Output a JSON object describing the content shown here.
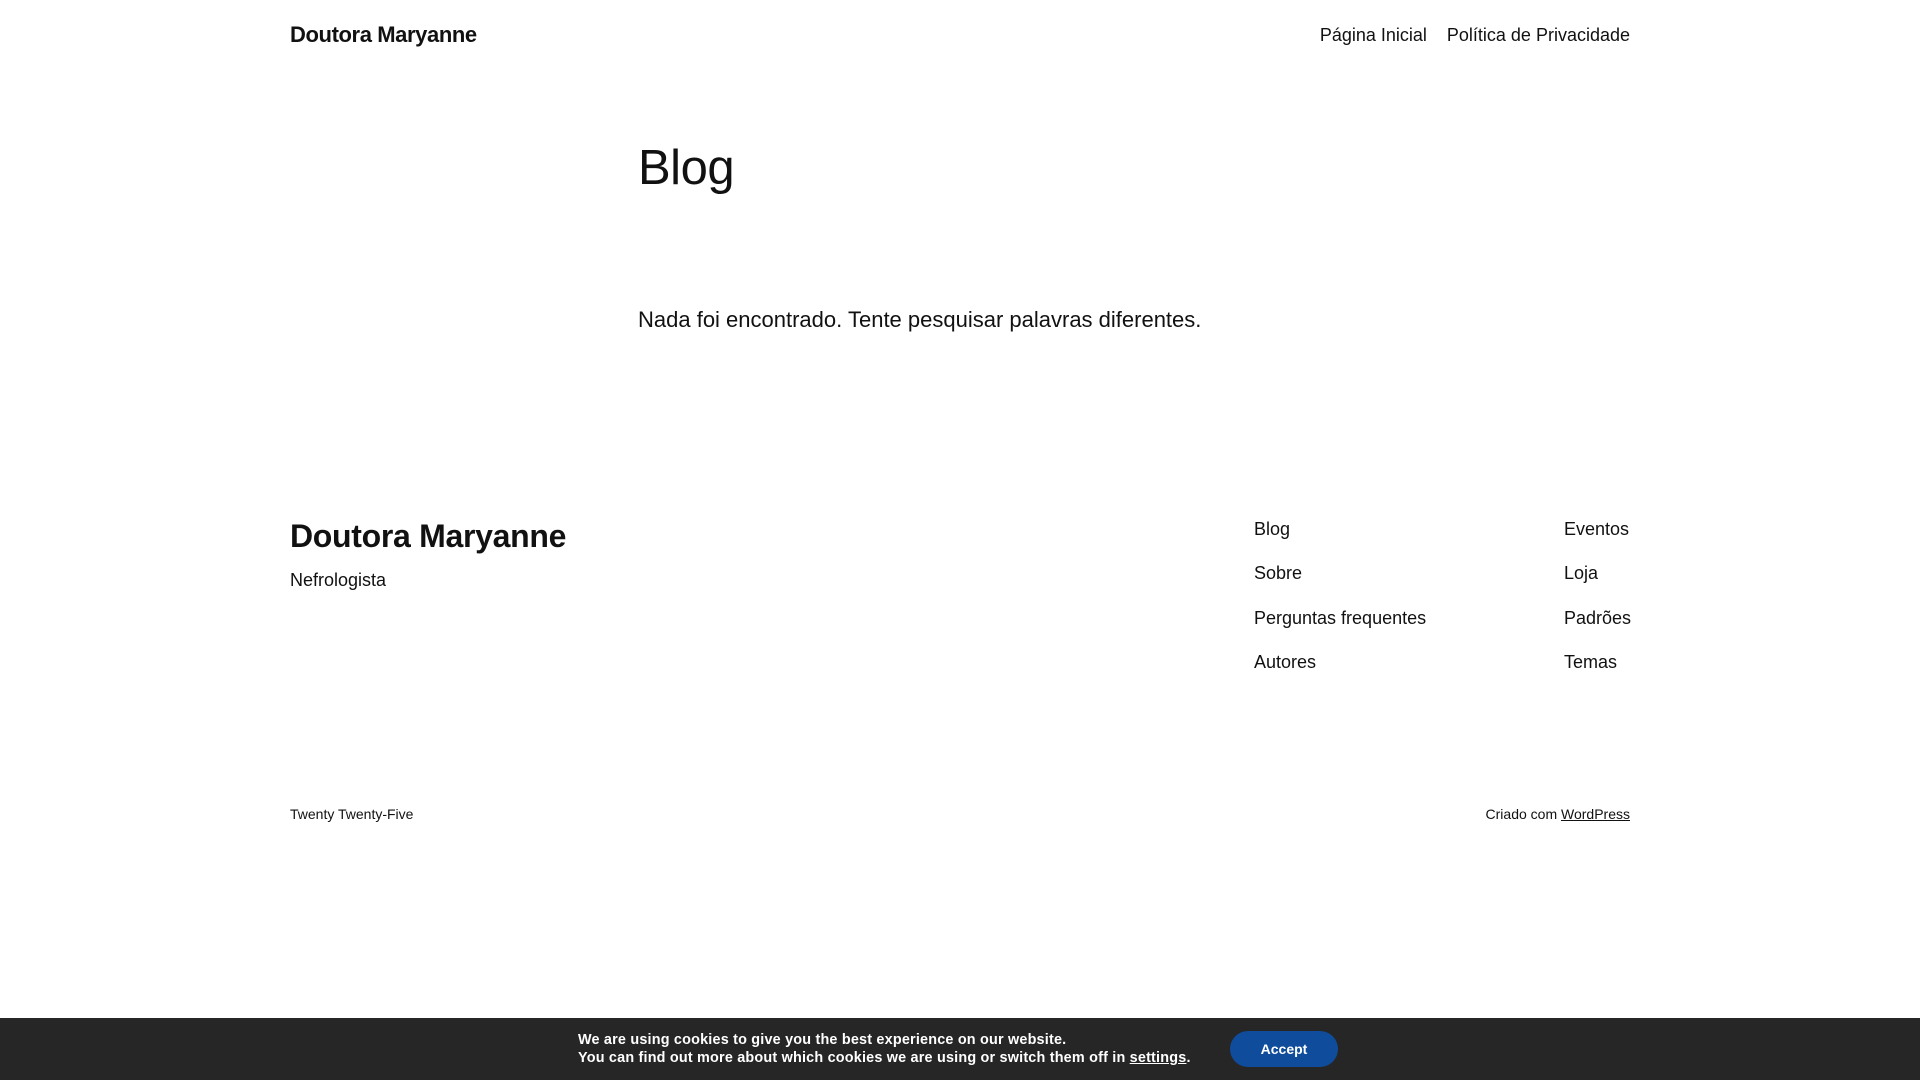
{
  "header": {
    "site_title": "Doutora Maryanne",
    "nav": [
      {
        "label": "Página Inicial"
      },
      {
        "label": "Política de Privacidade"
      }
    ]
  },
  "main": {
    "title": "Blog",
    "empty_message": "Nada foi encontrado. Tente pesquisar palavras diferentes."
  },
  "footer": {
    "site_title": "Doutora Maryanne",
    "tagline": "Nefrologista",
    "col1": [
      {
        "label": "Blog"
      },
      {
        "label": "Sobre"
      },
      {
        "label": "Perguntas frequentes"
      },
      {
        "label": "Autores"
      }
    ],
    "col2": [
      {
        "label": "Eventos"
      },
      {
        "label": "Loja"
      },
      {
        "label": "Padrões"
      },
      {
        "label": "Temas"
      }
    ],
    "theme_name": "Twenty Twenty-Five",
    "credit_prefix": "Criado com",
    "credit_link": "WordPress"
  },
  "cookie": {
    "line1": "We are using cookies to give you the best experience on our website.",
    "line2_prefix": "You can find out more about which cookies we are using or switch them off in",
    "settings_link": "settings",
    "line2_suffix": ".",
    "accept_label": "Accept",
    "bar_color": "#262626",
    "button_color": "#0f4d9c"
  }
}
